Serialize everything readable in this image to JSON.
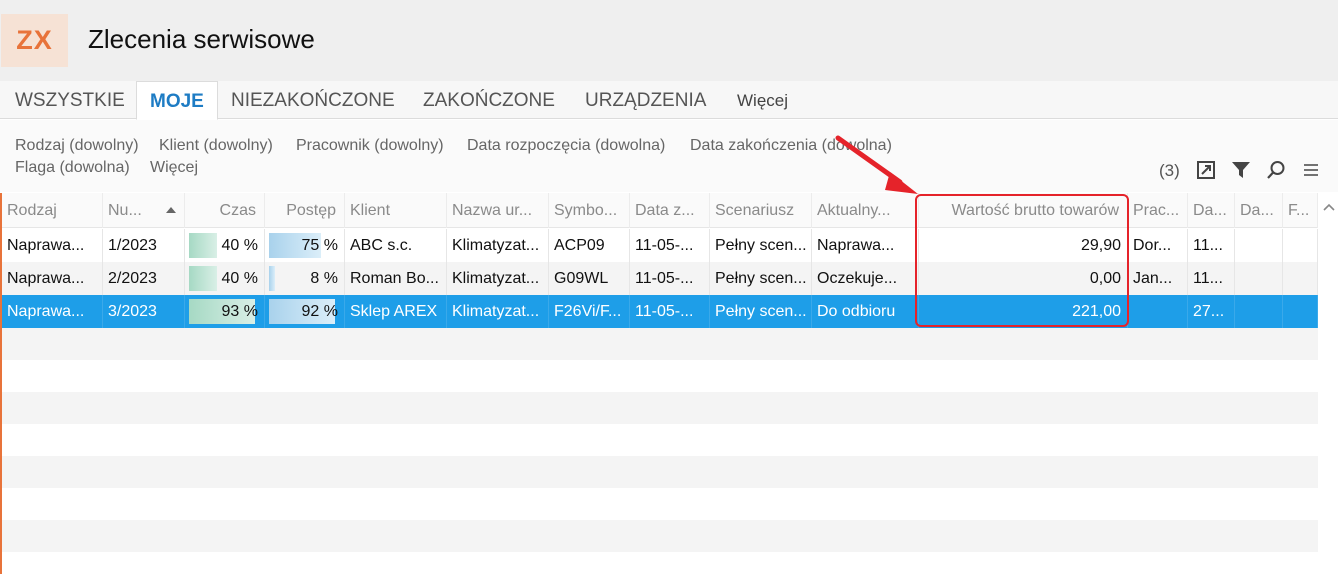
{
  "app": {
    "logo": "ZX",
    "title": "Zlecenia serwisowe"
  },
  "tabs": [
    {
      "label": "WSZYSTKIE"
    },
    {
      "label": "MOJE",
      "active": true
    },
    {
      "label": "NIEZAKOŃCZONE"
    },
    {
      "label": "ZAKOŃCZONE"
    },
    {
      "label": "URZĄDZENIA"
    },
    {
      "label": "Więcej"
    }
  ],
  "filters": {
    "row1": [
      "Rodzaj (dowolny)",
      "Klient (dowolny)",
      "Pracownik (dowolny)",
      "Data rozpoczęcia (dowolna)",
      "Data zakończenia (dowolna)"
    ],
    "row2": [
      "Flaga (dowolna)",
      "Więcej"
    ]
  },
  "toolbar": {
    "count": "(3)",
    "icons": [
      "export-icon",
      "filter-icon",
      "search-icon",
      "menu-icon"
    ]
  },
  "columns": [
    "Rodzaj",
    "Nu...",
    "Czas",
    "Postęp",
    "Klient",
    "Nazwa ur...",
    "Symbo...",
    "Data z...",
    "Scenariusz",
    "Aktualny...",
    "Wartość brutto towarów",
    "Prac...",
    "Da...",
    "Da...",
    "F..."
  ],
  "rows": [
    {
      "rodzaj": "Naprawa...",
      "numer": "1/2023",
      "czas": "40 %",
      "czas_fill": 0.4,
      "postep": "75 %",
      "postep_fill": 0.75,
      "klient": "ABC s.c.",
      "nazwa": "Klimatyzat...",
      "symbol": "ACP09",
      "data_z": "11-05-...",
      "scenariusz": "Pełny scen...",
      "aktualny": "Naprawa...",
      "wartosc": "29,90",
      "prac": "Dor...",
      "da1": "11...",
      "da2": "",
      "f": ""
    },
    {
      "rodzaj": "Naprawa...",
      "numer": "2/2023",
      "czas": "40 %",
      "czas_fill": 0.4,
      "postep": "8 %",
      "postep_fill": 0.08,
      "klient": "Roman Bo...",
      "nazwa": "Klimatyzat...",
      "symbol": "G09WL",
      "data_z": "11-05-...",
      "scenariusz": "Pełny scen...",
      "aktualny": "Oczekuje...",
      "wartosc": "0,00",
      "prac": "Jan...",
      "da1": "11...",
      "da2": "",
      "f": ""
    },
    {
      "rodzaj": "Naprawa...",
      "numer": "3/2023",
      "czas": "93 %",
      "czas_fill": 0.93,
      "postep": "92 %",
      "postep_fill": 0.92,
      "klient": "Sklep AREX",
      "nazwa": "Klimatyzat...",
      "symbol": "F26Vi/F...",
      "data_z": "11-05-...",
      "scenariusz": "Pełny scen...",
      "aktualny": "Do odbioru",
      "wartosc": "221,00",
      "prac": "",
      "da1": "27...",
      "da2": "",
      "f": "",
      "selected": true
    }
  ],
  "colors": {
    "accent": "#1e7cc4",
    "selection": "#1e9ee8",
    "logo": "#e8733a",
    "annotation": "#e5232a"
  }
}
